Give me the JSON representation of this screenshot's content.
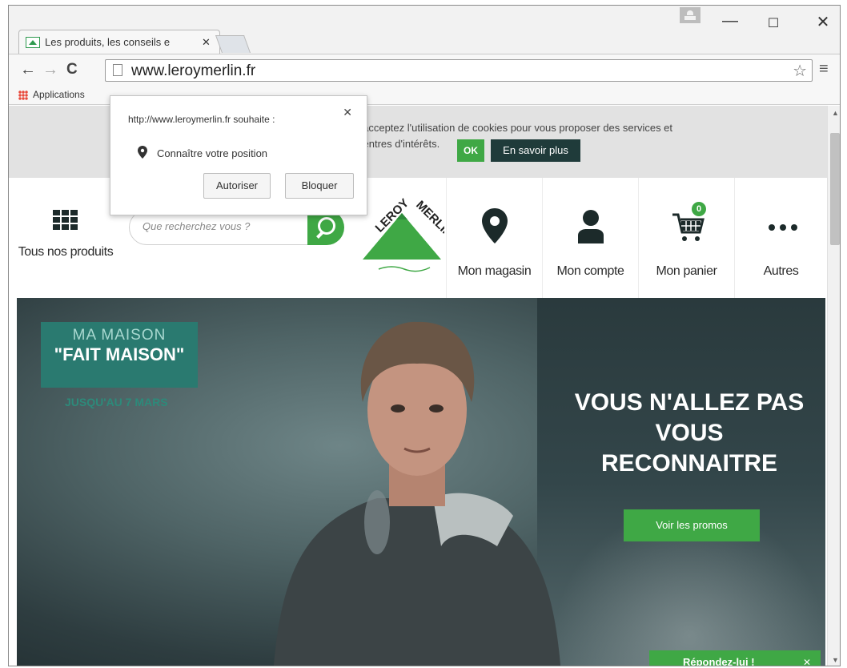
{
  "browser": {
    "tab_title": "Les produits, les conseils e",
    "tab_close": "✕",
    "url": "www.leroymerlin.fr",
    "bookmarks_apps": "Applications",
    "window_controls": {
      "minimize": "—",
      "maximize": "☐",
      "close": "✕"
    }
  },
  "permission_popup": {
    "title": "http://www.leroymerlin.fr souhaite :",
    "close": "✕",
    "request": "Connaître votre position",
    "allow_label": "Autoriser",
    "block_label": "Bloquer"
  },
  "cookie_bar": {
    "text_line1": "s acceptez l'utilisation de cookies pour vous proposer des services et",
    "text_line2": "centres d'intérêts.",
    "ok_label": "OK",
    "more_label": "En savoir plus"
  },
  "header": {
    "products_label": "Tous nos produits",
    "search_placeholder": "Que recherchez vous ?",
    "store_label": "Mon magasin",
    "account_label": "Mon compte",
    "cart_label": "Mon panier",
    "cart_count": "0",
    "more_label": "Autres",
    "logo_text": "LEROY MERLIN"
  },
  "hero": {
    "badge_line1": "MA MAISON",
    "badge_line2": "\"FAIT MAISON\"",
    "date": "JUSQU'AU 7 MARS",
    "headline": "VOUS N'ALLEZ PAS VOUS RECONNAITRE",
    "cta_label": "Voir les promos"
  },
  "chat": {
    "label": "Répondez-lui !",
    "close": "✕"
  },
  "colors": {
    "brand_green": "#3fa845",
    "teal": "#2a7a70",
    "dark": "#1f3b3a"
  }
}
